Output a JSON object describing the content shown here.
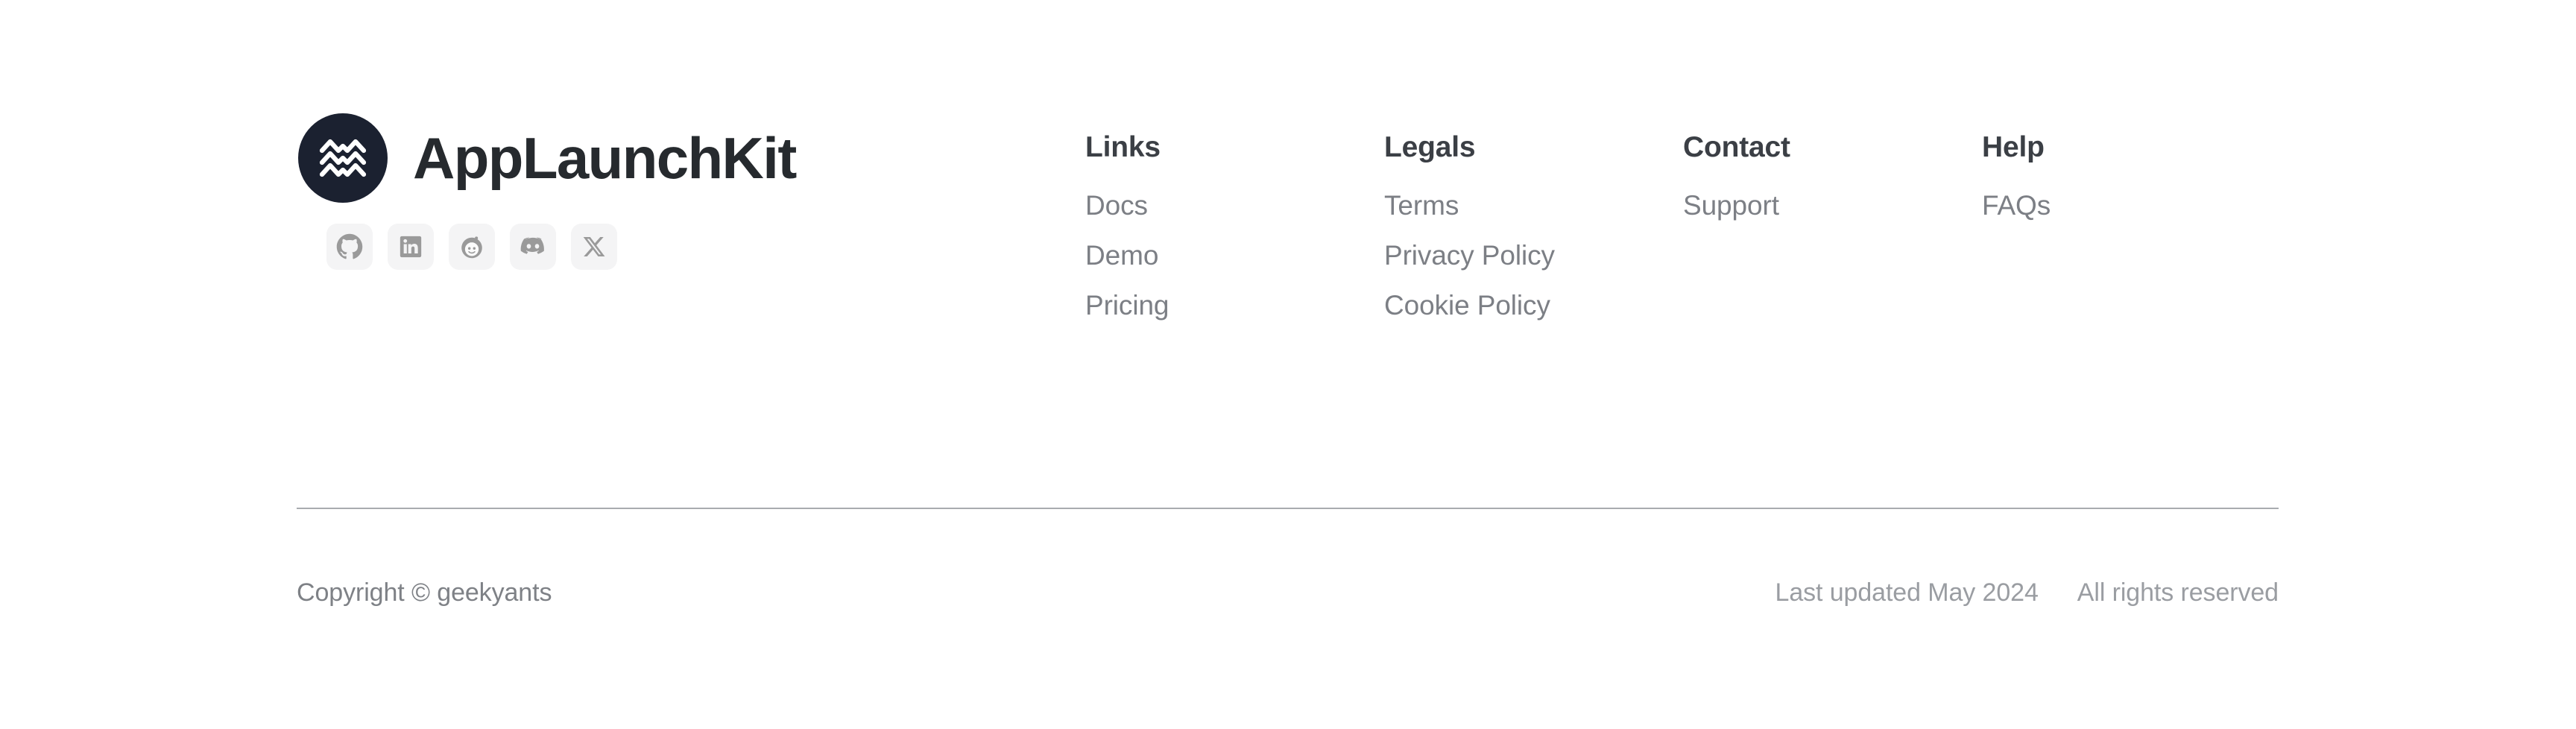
{
  "brand": {
    "name": "AppLaunchKit",
    "logo_icon": "applaunchkit-chevron-logo",
    "logo_bg_color": "#1b2130",
    "logo_mark_color": "#ffffff",
    "wordmark_color": "#262a2e"
  },
  "social": {
    "items": [
      {
        "icon": "github-icon",
        "label": "GitHub"
      },
      {
        "icon": "linkedin-icon",
        "label": "LinkedIn"
      },
      {
        "icon": "reddit-icon",
        "label": "Reddit"
      },
      {
        "icon": "discord-icon",
        "label": "Discord"
      },
      {
        "icon": "x-twitter-icon",
        "label": "X"
      }
    ],
    "button_bg_color": "#f4f4f5",
    "glyph_color": "#9a9a9a"
  },
  "columns": [
    {
      "title": "Links",
      "items": [
        {
          "label": "Docs"
        },
        {
          "label": "Demo"
        },
        {
          "label": "Pricing"
        }
      ]
    },
    {
      "title": "Legals",
      "items": [
        {
          "label": "Terms"
        },
        {
          "label": "Privacy Policy"
        },
        {
          "label": "Cookie Policy"
        }
      ]
    },
    {
      "title": "Contact",
      "items": [
        {
          "label": "Support"
        }
      ]
    },
    {
      "title": "Help",
      "items": [
        {
          "label": "FAQs"
        }
      ]
    }
  ],
  "divider": {
    "color": "#a9abaf"
  },
  "bottom_bar": {
    "copyright": "Copyright © geekyants",
    "last_updated": "Last updated May 2024",
    "rights": "All rights reserved",
    "text_color": "#7e8186"
  },
  "theme": {
    "background": "#ffffff",
    "heading_color": "#3b3f45",
    "link_color": "#7c7f85"
  }
}
